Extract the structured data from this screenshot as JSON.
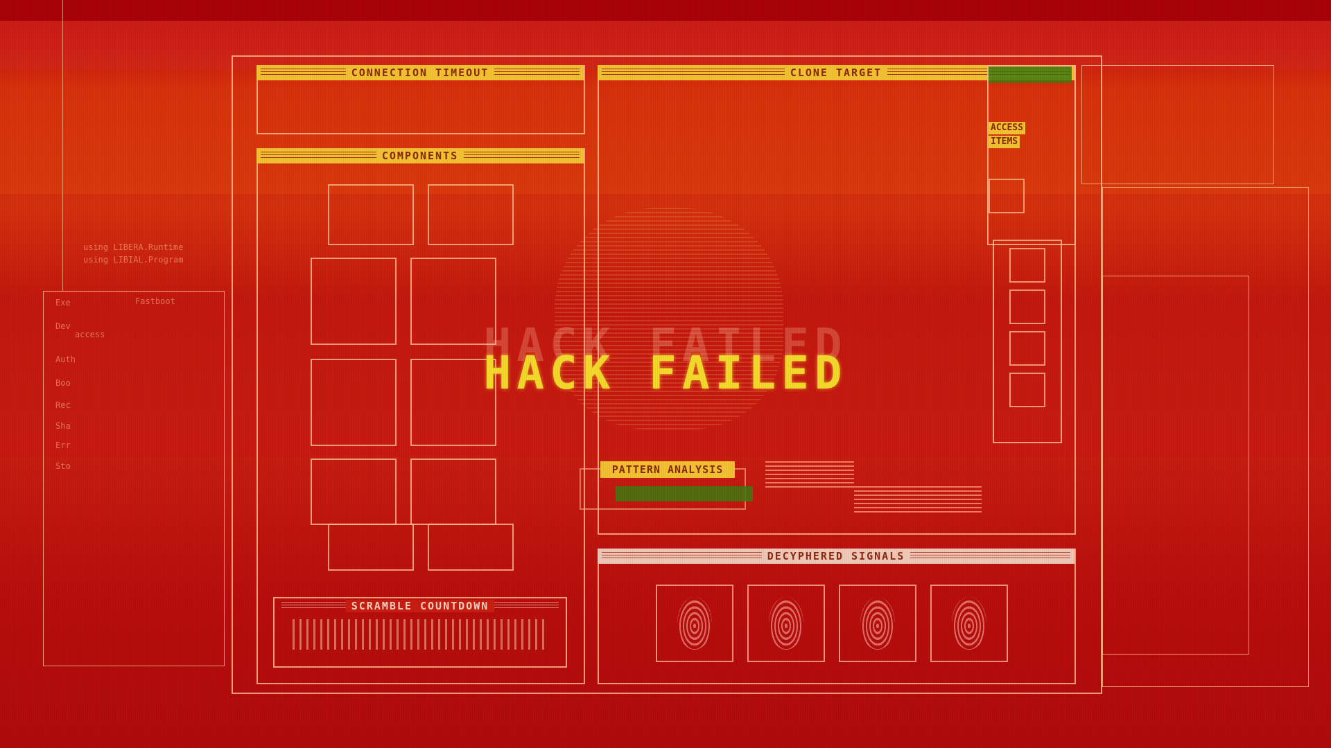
{
  "screen": {
    "title": "HACK FAILED",
    "ghost_title": "HACK FAILED"
  },
  "panels": {
    "connection_timeout": "CONNECTION TIMEOUT",
    "clone_target": "CLONE TARGET",
    "components": "COMPONENTS",
    "pattern_analysis": "PATTERN ANALYSIS",
    "decyphered_signals": "DECYPHERED SIGNALS",
    "scramble_countdown": "SCRAMBLE COUNTDOWN"
  },
  "side_panel": {
    "access_label": "ACCESS",
    "items_label": "ITEMS"
  },
  "background_text": {
    "lines": [
      "using LIBERA.Runtime",
      "using LIBIAL.Program",
      "Fastboot",
      "access"
    ],
    "left_labels": [
      "Exe",
      "Dev",
      "Auth",
      "Boo",
      "Rec",
      "Sha",
      "Err",
      "Sto"
    ]
  },
  "colors": {
    "accent_yellow": "#f2c233",
    "title_yellow": "#f4d92a",
    "background_red": "#c81d10",
    "frame_peach": "#ffb98c",
    "status_green": "#3f7a10"
  }
}
